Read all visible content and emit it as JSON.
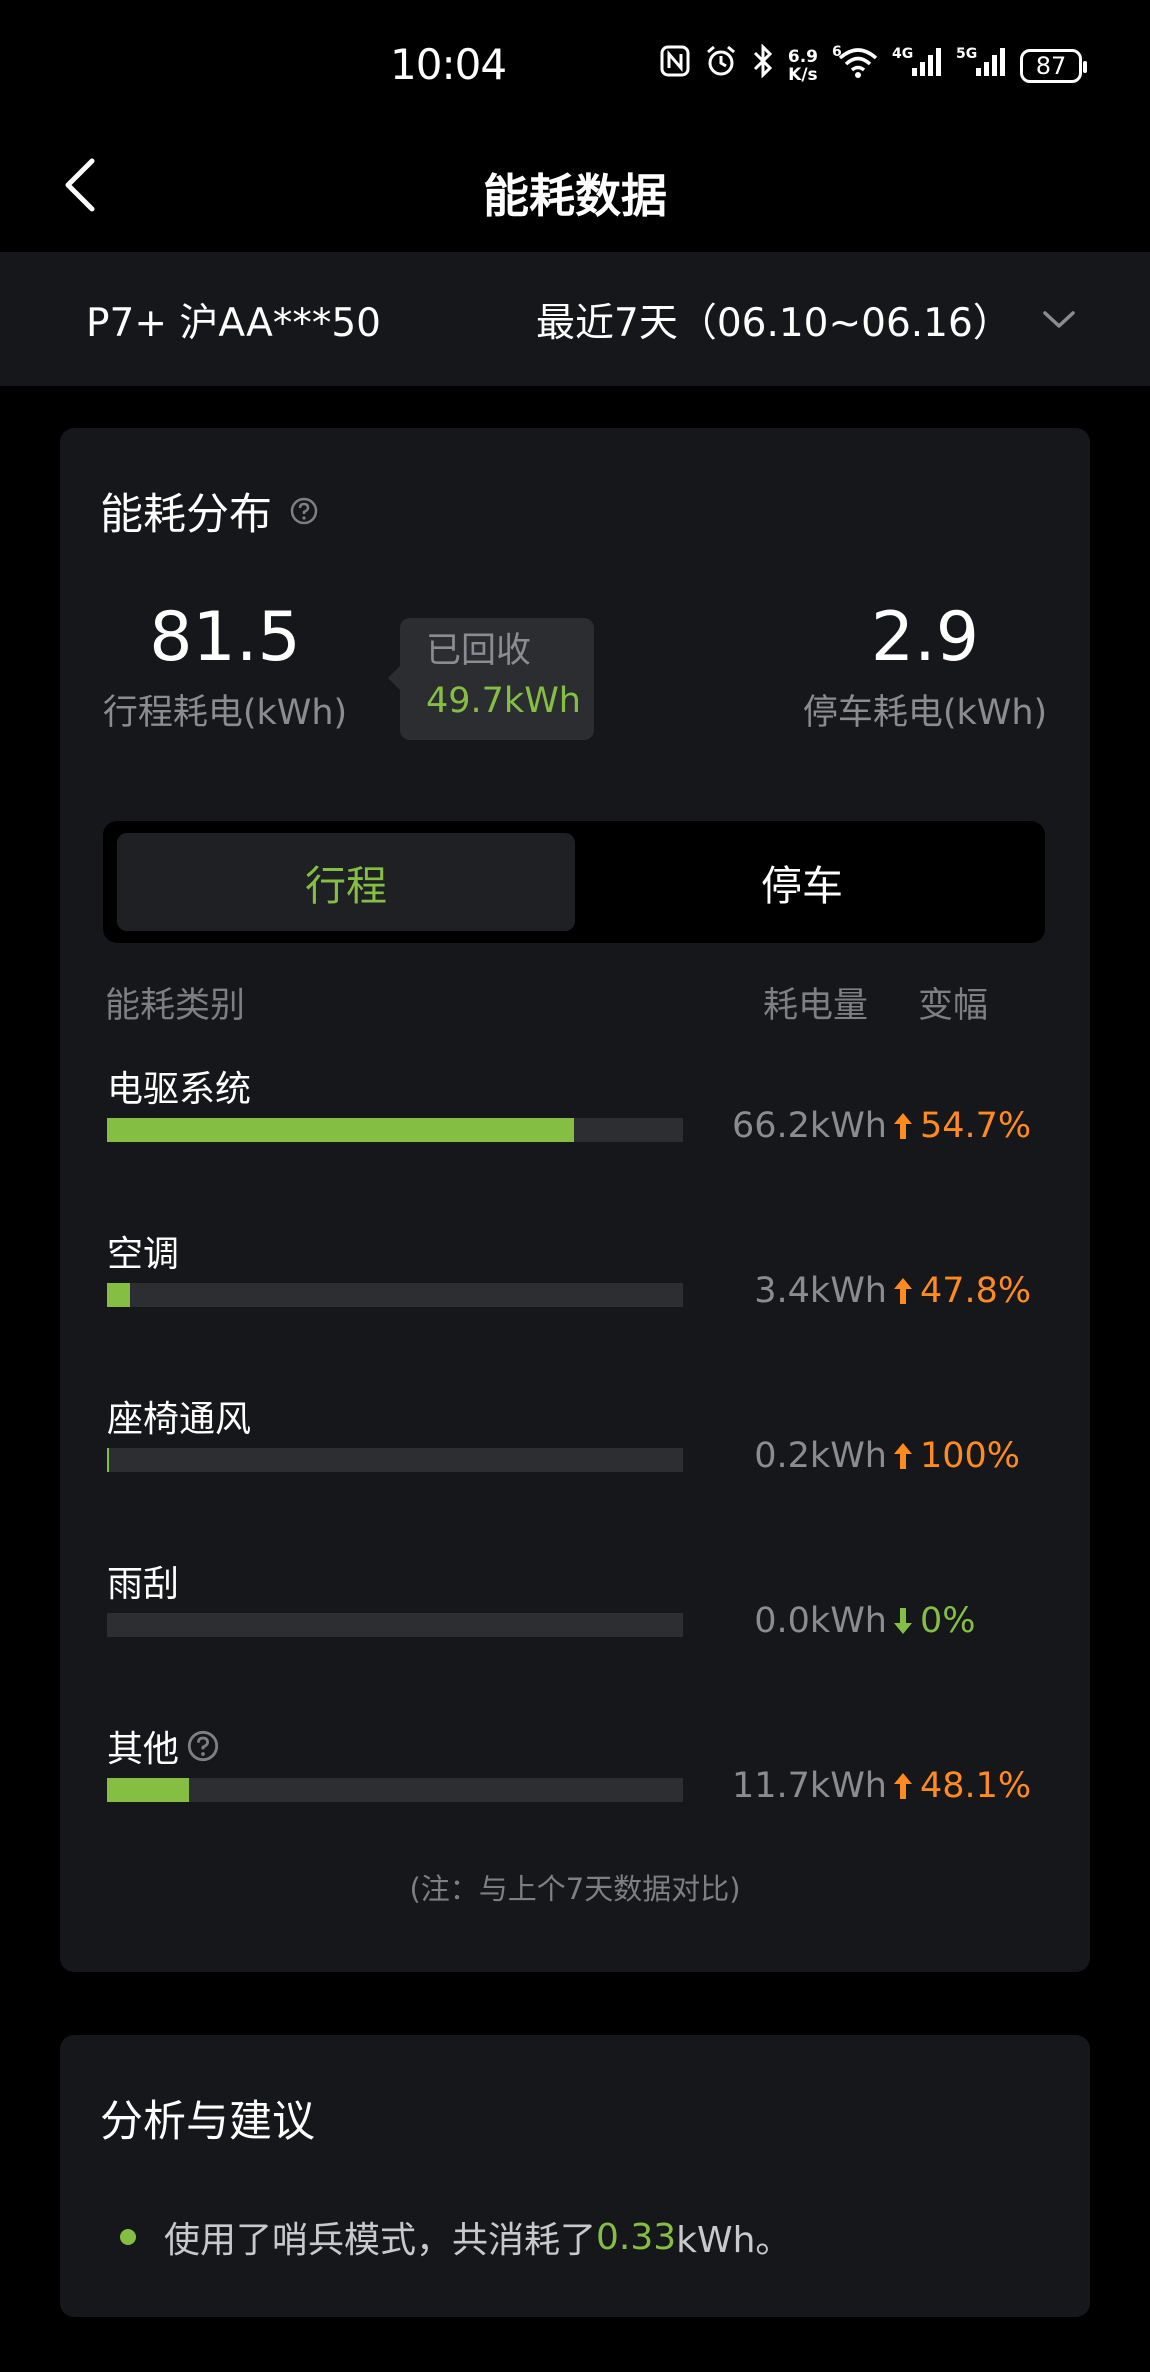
{
  "status_bar": {
    "time": "10:04",
    "speed_value": "6.9",
    "speed_unit": "K/s",
    "wifi_sub": "6",
    "net1": "4G",
    "net2": "5G",
    "battery": "87"
  },
  "header": {
    "title": "能耗数据"
  },
  "selector": {
    "vehicle": "P7+ 沪AA***50",
    "range": "最近7天（06.10~06.16）"
  },
  "distribution": {
    "title": "能耗分布",
    "trip_value": "81.5",
    "trip_label": "行程耗电(kWh)",
    "recycled_title": "已回收",
    "recycled_value": "49.7kWh",
    "parking_value": "2.9",
    "parking_label": "停车耗电(kWh)",
    "tabs": [
      {
        "label": "行程",
        "active": true
      },
      {
        "label": "停车",
        "active": false
      }
    ],
    "columns": {
      "category": "能耗类别",
      "amount": "耗电量",
      "change": "变幅"
    },
    "rows": [
      {
        "label": "电驱系统",
        "amount": "66.2kWh",
        "change": "54.7%",
        "direction": "up",
        "fill": 0.81
      },
      {
        "label": "空调",
        "amount": "3.4kWh",
        "change": "47.8%",
        "direction": "up",
        "fill": 0.04
      },
      {
        "label": "座椅通风",
        "amount": "0.2kWh",
        "change": "100%",
        "direction": "up",
        "fill": 0.003
      },
      {
        "label": "雨刮",
        "amount": "0.0kWh",
        "change": "0%",
        "direction": "down",
        "fill": 0
      },
      {
        "label": "其他",
        "amount": "11.7kWh",
        "change": "48.1%",
        "direction": "up",
        "fill": 0.143,
        "has_help": true
      }
    ],
    "note": "(注：与上个7天数据对比)"
  },
  "analysis": {
    "title": "分析与建议",
    "item_prefix": "使用了哨兵模式，共消耗了",
    "item_value": "0.33",
    "item_suffix": "kWh。"
  },
  "colors": {
    "accent_green": "#84bf43",
    "up_orange": "#ff8a1f",
    "card_bg": "#16171a"
  }
}
